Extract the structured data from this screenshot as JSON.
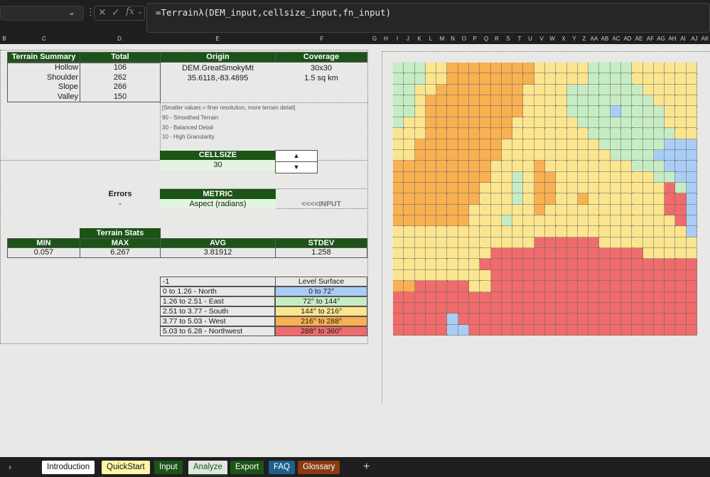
{
  "formula_bar": {
    "formula": "=Terrainλ(DEM_input,cellsize_input,fn_input)",
    "fx": "fx"
  },
  "columns": [
    "B",
    "C",
    "D",
    "E",
    "F",
    "G",
    "H",
    "I",
    "J",
    "K",
    "L",
    "M",
    "N",
    "O",
    "P",
    "Q",
    "R",
    "S",
    "T",
    "U",
    "V",
    "W",
    "X",
    "Y",
    "Z",
    "AA",
    "AB",
    "AC",
    "AD",
    "AE",
    "AF",
    "AG",
    "AH",
    "AI",
    "AJ",
    "AK"
  ],
  "summary": {
    "headers": [
      "Terrain Summary",
      "Total",
      "Origin",
      "Coverage"
    ],
    "rows": [
      {
        "label": "Hollow",
        "total": "106"
      },
      {
        "label": "Shoulder",
        "total": "262"
      },
      {
        "label": "Slope",
        "total": "266"
      },
      {
        "label": "Valley",
        "total": "150"
      }
    ],
    "origin_name": "DEM.GreatSmokyMt",
    "origin_coords": "35.6118,-83.4895",
    "coverage_grid": "30x30",
    "coverage_area": "1.5 sq km"
  },
  "notes": [
    "[Smaller values = finer resolution, more terrain detail]",
    "90 - Smoothed Terrain",
    "30 - Balanced Detail",
    "10 - High Granularity"
  ],
  "cellsize": {
    "label": "CELLSIZE",
    "value": "30",
    "up": "▲",
    "down": "▼"
  },
  "errors": {
    "label": "Errors",
    "value": "-"
  },
  "metric": {
    "label": "METRIC",
    "value": "Aspect (radians)",
    "input_hint": "<<<<INPUT"
  },
  "stats": {
    "title": "Terrain Stats",
    "headers": [
      "MIN",
      "MAX",
      "AVG",
      "STDEV"
    ],
    "values": [
      "0.057",
      "6.267",
      "3.81912",
      "1.258"
    ]
  },
  "legend": {
    "top_left": "-1",
    "top_right": "Level Surface",
    "rows": [
      {
        "range": "0 to 1.26 - North",
        "deg": "0 to 72°",
        "color": "#a9cdf5"
      },
      {
        "range": "1.26 to 2.51 - East",
        "deg": "72° to 144°",
        "color": "#c6ecc3"
      },
      {
        "range": "2.51 to 3.77 - South",
        "deg": "144° to 216°",
        "color": "#fbe58f"
      },
      {
        "range": "3.77 to 5.03 - West",
        "deg": "216° to 288°",
        "color": "#f8b050"
      },
      {
        "range": "5.03 to 6.28 - Northwest",
        "deg": "288° to 360°",
        "color": "#f06b6b"
      }
    ]
  },
  "tabs": [
    {
      "label": "Introduction",
      "bg": "#ffffff",
      "fg": "#111111"
    },
    {
      "label": "QuickStart",
      "bg": "#fff7a8",
      "fg": "#111111"
    },
    {
      "label": "Input",
      "bg": "#1c5417",
      "fg": "#ffffff"
    },
    {
      "label": "Analyze",
      "bg": "#dfe7df",
      "fg": "#1c5417"
    },
    {
      "label": "Export",
      "bg": "#1c5417",
      "fg": "#ffffff"
    },
    {
      "label": "FAQ",
      "bg": "#1f5f8b",
      "fg": "#ffffff"
    },
    {
      "label": "Glossary",
      "bg": "#8b3a12",
      "fg": "#ffffff"
    }
  ],
  "palette": {
    "N": "#a9cdf5",
    "E": "#c6ecc3",
    "S": "#fbe58f",
    "W": "#f8b050",
    "NW": "#f06b6b"
  },
  "aspect_map_rows": [
    "GGGSSWWWWWWWWSSSSSGGGGSSSSSS",
    "GGGSSWWWWWWWWSSSSSGGGGSSSSSS",
    "GGSSWWWWWWWWSSSSGGGGGGGSSSSS",
    "GGSWWWWWWWWWSSSSGGGGGGGGSSSS",
    "GGSWWWWWWWWWSSSSGGGGNGGGGSSS",
    "GSSWWWWWWWWSSSSSSGGGGGGGGSSS",
    "SSSWWWWWWWWSSSSSSSGGGGGGGGSS",
    "SSWWWWWWWWSSSSSSSSSGGGGGGNNN",
    "SSWWWWWWWWSSSSSSSSSSGGGGNNNN",
    "WWWWWWWWWSSSSWSSSSSSSSGGGNNN",
    "WWWWWWWWWSSGSWWSSSSSSSSSGGNN",
    "WWWWWWWWSSSGSWWSSSSSSSSSSRGN",
    "WWWWWWWWSSSGSWWSSWSSSSSSSRRN",
    "WWWWWWWSSSSSSWSSSSSSSSSSSRRN",
    "WWWWWWWSSSGSSSSSSSSSSSSSSSRN",
    "SSSSSSSSSSSSSSSSSSSSSSSSSSSN",
    "SSSSSSSSSSSSSRRRRRRSSSSSSSSS",
    "SSSSSSSSSRRRRRRRRRRRRRRSSSSS",
    "SSSSSSSSRRRRRRRRRRRRRRRRRRRR",
    "SSSSSSSSSRRRRRRRRRRRRRRRRRRR",
    "WWRRRRRSSRRRRRRRRRRRRRRRRRRR",
    "RRRRRRRRRRRRRRRRRRRRRRRRRRRR",
    "RRRRRRRRRRRRRRRRRRRRRRRRRRRR",
    "RRRRRNRRRRRRRRRRRRRRRRRRRRRR",
    "RRRRRNNRRRRRRRRRRRRRRRRRRRRR"
  ]
}
